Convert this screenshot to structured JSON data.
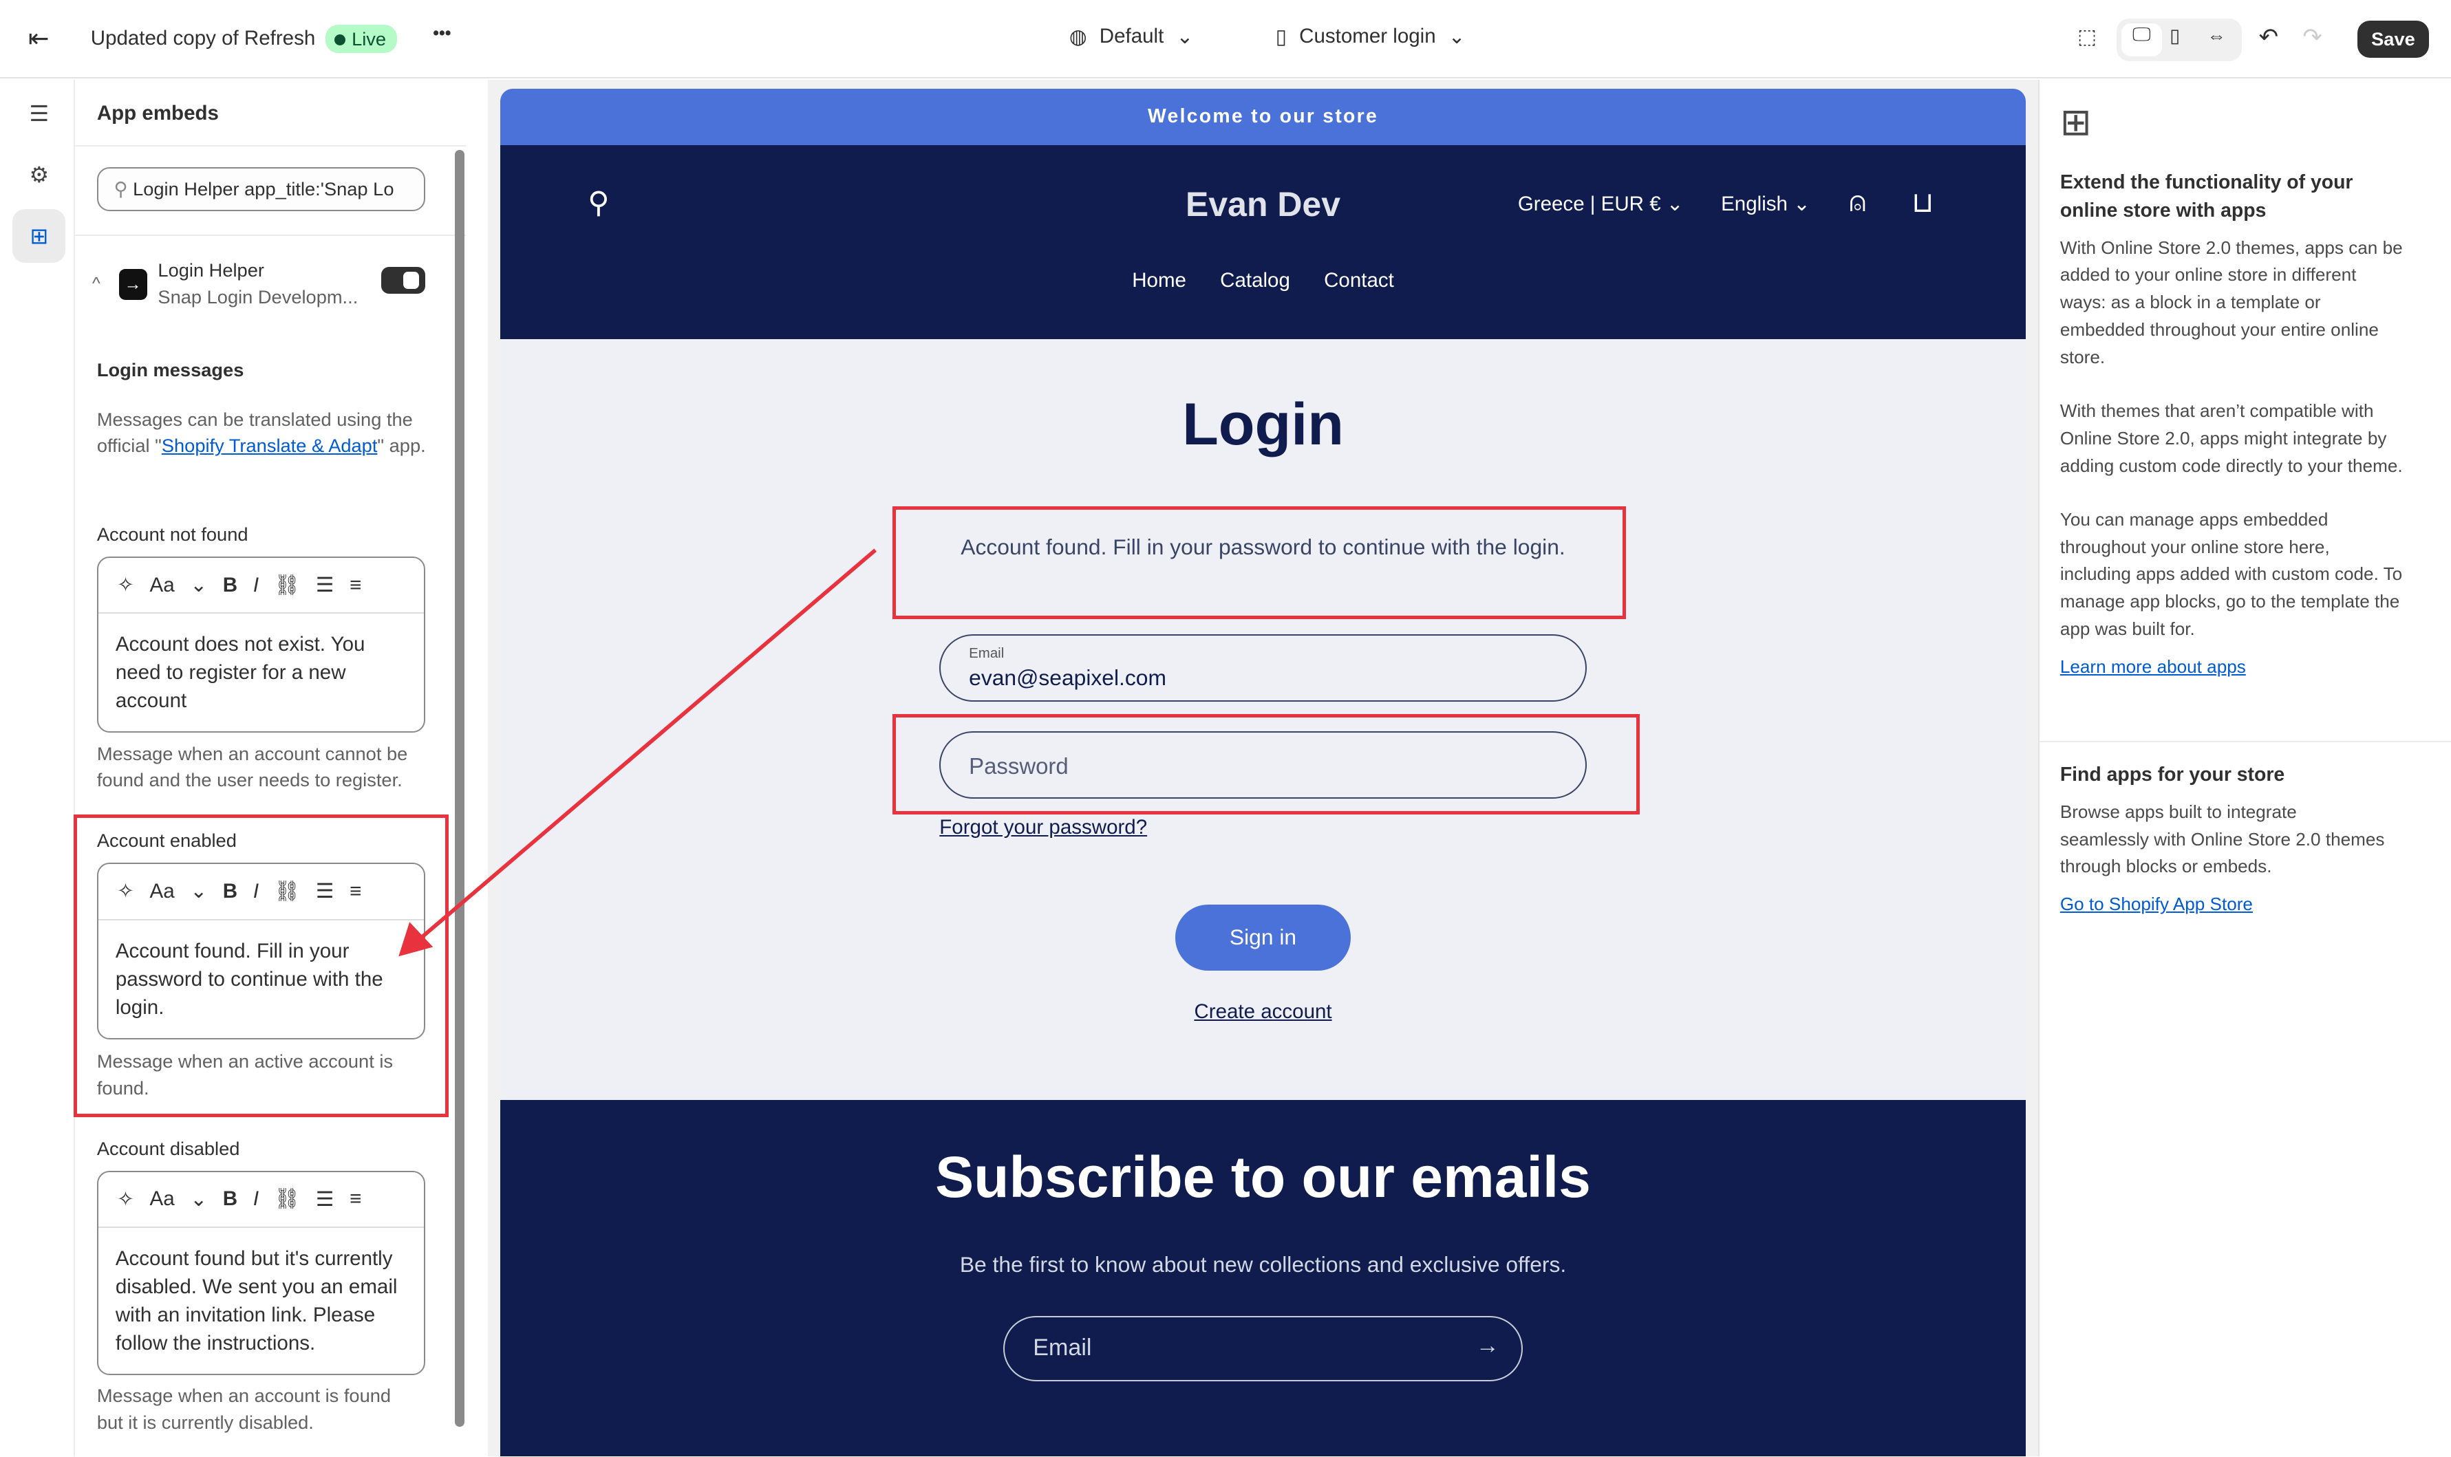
{
  "topbar": {
    "title": "Updated copy of Refresh",
    "status": "Live",
    "more": "•••",
    "theme_select": "Default",
    "page_select": "Customer login",
    "save": "Save"
  },
  "sidebar": {
    "heading": "App embeds",
    "search_value": "Login Helper app_title:'Snap Lo",
    "app": {
      "name": "Login Helper",
      "developer": "Snap Login Developm...",
      "enabled": true
    },
    "section_title": "Login messages",
    "intro_pre": "Messages can be translated using the official \"",
    "intro_link": "Shopify Translate & Adapt",
    "intro_post": "\" app.",
    "toolbar": {
      "font": "Aa"
    },
    "fields": [
      {
        "label": "Account not found",
        "value": "Account does not exist. You need to register for a new account",
        "help": "Message when an account cannot be found and the user needs to register."
      },
      {
        "label": "Account enabled",
        "value": "Account found. Fill in your password to continue with the login.",
        "help": "Message when an active account is found."
      },
      {
        "label": "Account disabled",
        "value": "Account found but it's currently disabled. We sent you an email with an invitation link. Please follow the instructions.",
        "help": "Message when an account is found but it is currently disabled."
      }
    ]
  },
  "store": {
    "announcement": "Welcome to our store",
    "name": "Evan Dev",
    "locale": "Greece | EUR €",
    "language": "English",
    "nav": [
      "Home",
      "Catalog",
      "Contact"
    ],
    "login_title": "Login",
    "message": "Account found. Fill in your password to continue with the login.",
    "email_label": "Email",
    "email_value": "evan@seapixel.com",
    "password_placeholder": "Password",
    "forgot": "Forgot your password?",
    "sign_in": "Sign in",
    "create": "Create account",
    "subscribe_title": "Subscribe to our emails",
    "subscribe_text": "Be the first to know about new collections and exclusive offers.",
    "subscribe_placeholder": "Email"
  },
  "right": {
    "heading": "Extend the functionality of your online store with apps",
    "p1": "With Online Store 2.0 themes, apps can be added to your online store in different ways: as a block in a template or embedded throughout your entire online store.",
    "p2": "With themes that aren’t compatible with Online Store 2.0, apps might integrate by adding custom code directly to your theme.",
    "p3": "You can manage apps embedded throughout your online store here, including apps added with custom code. To manage app blocks, go to the template the app was built for.",
    "link1": "Learn more about apps",
    "heading2": "Find apps for your store",
    "p4": "Browse apps built to integrate seamlessly with Online Store 2.0 themes through blocks or embeds.",
    "link2": "Go to Shopify App Store"
  },
  "colors": {
    "announcement": "#4a72d9",
    "navy": "#0f1c4d",
    "login_bg": "#eef0f5",
    "annotation": "#e8333f",
    "live": "#b4fbc8"
  }
}
